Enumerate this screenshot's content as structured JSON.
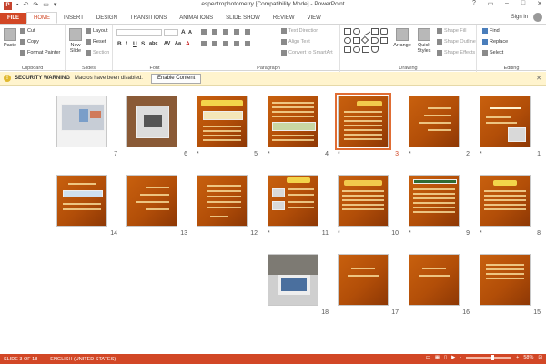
{
  "app": {
    "title": "espectrophotometry [Compatibility Mode] - PowerPoint",
    "help": "?",
    "sign_in": "Sign in",
    "colors": {
      "accent": "#d24726",
      "slide_bg": "#b24e08",
      "warning_bg": "#fff4ce"
    },
    "qat_icons": [
      "powerpoint-icon",
      "save-icon",
      "undo-icon",
      "redo-icon",
      "start-from-beginning-icon",
      "customize-icon"
    ]
  },
  "tabs": [
    {
      "label": "FILE"
    },
    {
      "label": "HOME"
    },
    {
      "label": "INSERT"
    },
    {
      "label": "DESIGN"
    },
    {
      "label": "TRANSITIONS"
    },
    {
      "label": "ANIMATIONS"
    },
    {
      "label": "SLIDE SHOW"
    },
    {
      "label": "REVIEW"
    },
    {
      "label": "VIEW"
    }
  ],
  "ribbon": {
    "clipboard": {
      "label": "Clipboard",
      "paste": "Paste",
      "cut": "Cut",
      "copy": "Copy",
      "format_painter": "Format Painter"
    },
    "slides": {
      "label": "Slides",
      "new_slide": "New Slide",
      "layout": "Layout",
      "reset": "Reset",
      "section": "Section"
    },
    "font": {
      "label": "Font"
    },
    "paragraph": {
      "label": "Paragraph",
      "text_direction": "Text Direction",
      "align_text": "Align Text",
      "convert_smartart": "Convert to SmartArt"
    },
    "drawing": {
      "label": "Drawing",
      "arrange": "Arrange",
      "quick_styles": "Quick Styles",
      "shape_fill": "Shape Fill",
      "shape_outline": "Shape Outline",
      "shape_effects": "Shape Effects"
    },
    "editing": {
      "label": "Editing",
      "find": "Find",
      "replace": "Replace",
      "select": "Select"
    }
  },
  "security_bar": {
    "title": "SECURITY WARNING",
    "message": "Macros have been disabled.",
    "button": "Enable Content"
  },
  "slides": [
    {
      "number": "1",
      "star": "*"
    },
    {
      "number": "2",
      "star": "*"
    },
    {
      "number": "3",
      "star": "*",
      "selected": true
    },
    {
      "number": "4",
      "star": "*"
    },
    {
      "number": "5",
      "star": "*"
    },
    {
      "number": "6",
      "star": ""
    },
    {
      "number": "7",
      "star": ""
    },
    {
      "number": "8",
      "star": "*"
    },
    {
      "number": "9",
      "star": "*"
    },
    {
      "number": "10",
      "star": "*"
    },
    {
      "number": "11",
      "star": "*"
    },
    {
      "number": "12",
      "star": ""
    },
    {
      "number": "13",
      "star": ""
    },
    {
      "number": "14",
      "star": ""
    },
    {
      "number": "15",
      "star": ""
    },
    {
      "number": "16",
      "star": ""
    },
    {
      "number": "17",
      "star": ""
    },
    {
      "number": "18",
      "star": ""
    }
  ],
  "status": {
    "slide_count": "SLIDE 3 OF 18",
    "language": "ENGLISH (UNITED STATES)",
    "zoom": "58%",
    "zoom_minus": "-",
    "zoom_plus": "+"
  }
}
